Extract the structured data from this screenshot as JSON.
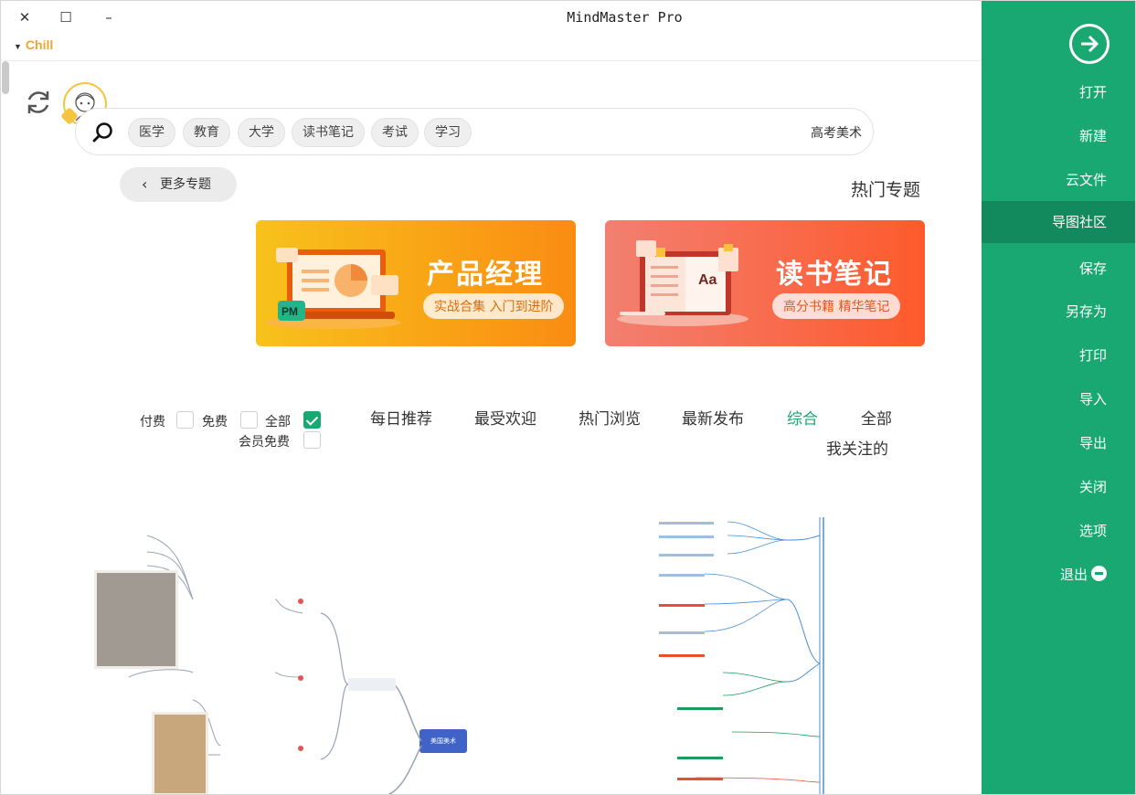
{
  "window": {
    "title": "MindMaster Pro",
    "close_glyph": "✕",
    "maximize_glyph": "☐",
    "minimize_glyph": "–"
  },
  "brand": {
    "label": "Chill",
    "color": "#f3a42f"
  },
  "sidebar": {
    "bg_color": "#1aa872",
    "active_color": "#138a5d",
    "items": [
      {
        "label": "打开"
      },
      {
        "label": "新建"
      },
      {
        "label": "云文件"
      },
      {
        "label": "导图社区",
        "active": true
      },
      {
        "label": "保存"
      },
      {
        "label": "另存为"
      },
      {
        "label": "打印"
      },
      {
        "label": "导入"
      },
      {
        "label": "导出"
      },
      {
        "label": "关闭"
      },
      {
        "label": "选项"
      },
      {
        "label": "退出",
        "icon": "minus-circle-icon"
      }
    ]
  },
  "search": {
    "value": "高考美术",
    "tags": [
      "学习",
      "考试",
      "读书笔记",
      "大学",
      "教育",
      "医学"
    ]
  },
  "hot_topics": {
    "title": "热门专题",
    "more_label": "更多专题",
    "banners": [
      {
        "title": "读书笔记",
        "subtitle": "高分书籍 精华笔记",
        "color": "#fe5a2c"
      },
      {
        "title": "产品经理",
        "subtitle": "实战合集 入门到进阶",
        "color": "#fa8c12",
        "badge": "PM"
      }
    ]
  },
  "filters": {
    "tabs": [
      {
        "label": "全部"
      },
      {
        "label": "综合",
        "active": true
      },
      {
        "label": "最新发布"
      },
      {
        "label": "热门浏览"
      },
      {
        "label": "最受欢迎"
      },
      {
        "label": "每日推荐"
      },
      {
        "label": "我关注的"
      }
    ],
    "checkboxes": [
      {
        "label": "全部",
        "checked": true
      },
      {
        "label": "免费",
        "checked": false
      },
      {
        "label": "付费",
        "checked": false
      },
      {
        "label": "会员免费",
        "checked": false
      }
    ]
  },
  "previews": {
    "left": {
      "center_label": "美国美术"
    },
    "right": {}
  }
}
